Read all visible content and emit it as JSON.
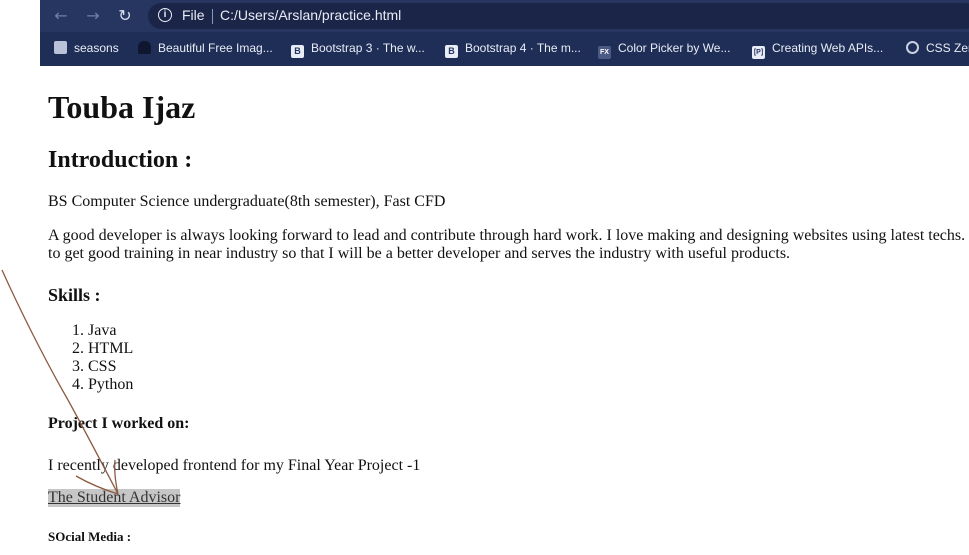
{
  "browser": {
    "back_icon": "arrow-left",
    "forward_icon": "arrow-right",
    "reload_icon": "reload",
    "address": {
      "scheme": "File",
      "url": "C:/Users/Arslan/practice.html"
    },
    "bookmarks": [
      {
        "label": "seasons",
        "icon": "page-icon"
      },
      {
        "label": "Beautiful Free Imag...",
        "icon": "user-icon"
      },
      {
        "label": "Bootstrap 3 · The w...",
        "icon": "bootstrap-icon",
        "glyph": "B"
      },
      {
        "label": "Bootstrap 4 · The m...",
        "icon": "bootstrap-icon",
        "glyph": "B"
      },
      {
        "label": "Color Picker by We...",
        "icon": "fx-icon",
        "glyph": "FX"
      },
      {
        "label": "Creating Web APIs...",
        "icon": "pluralsight-icon",
        "glyph": "[P]"
      },
      {
        "label": "CSS Zen",
        "icon": "github-icon"
      }
    ]
  },
  "page": {
    "name": "Touba Ijaz",
    "intro_heading": "Introduction :",
    "degree": "BS Computer Science undergraduate(8th semester), Fast CFD",
    "bio": "A good developer is always looking forward to lead and contribute through hard work. I love making and designing websites using latest techs. aim is to get good training in near industry so that I will be a better developer and serves the industry with useful products.",
    "skills_heading": "Skills :",
    "skills": [
      "Java",
      "HTML",
      "CSS",
      "Python"
    ],
    "project_heading": "Project I worked on:",
    "project_text": "I recently developed frontend for my Final Year Project -1",
    "project_link": "The Student Advisor",
    "social_heading": "SOcial Media :"
  }
}
